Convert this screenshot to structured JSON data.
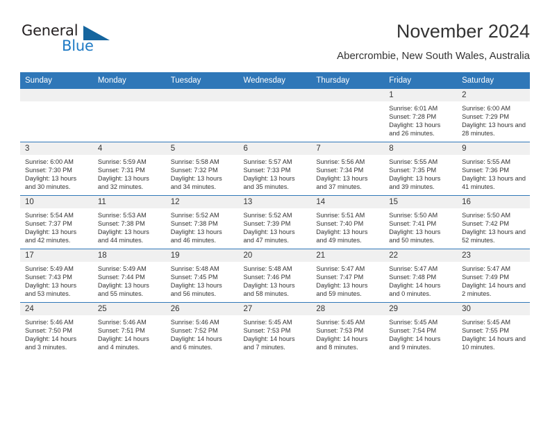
{
  "brand": {
    "name_part1": "General",
    "name_part2": "Blue",
    "triangle_color": "#15659e",
    "blue_color": "#1f7ac4"
  },
  "header": {
    "title": "November 2024",
    "subtitle": "Abercrombie, New South Wales, Australia"
  },
  "theme": {
    "header_bg": "#2f77b8",
    "daynum_band_bg": "#f0f0f0",
    "text": "#333333",
    "grid_line": "#2f77b8"
  },
  "weekdays": [
    "Sunday",
    "Monday",
    "Tuesday",
    "Wednesday",
    "Thursday",
    "Friday",
    "Saturday"
  ],
  "weeks": [
    [
      {
        "day": "",
        "empty": true
      },
      {
        "day": "",
        "empty": true
      },
      {
        "day": "",
        "empty": true
      },
      {
        "day": "",
        "empty": true
      },
      {
        "day": "",
        "empty": true
      },
      {
        "day": "1",
        "sunrise": "Sunrise: 6:01 AM",
        "sunset": "Sunset: 7:28 PM",
        "daylight": "Daylight: 13 hours and 26 minutes."
      },
      {
        "day": "2",
        "sunrise": "Sunrise: 6:00 AM",
        "sunset": "Sunset: 7:29 PM",
        "daylight": "Daylight: 13 hours and 28 minutes."
      }
    ],
    [
      {
        "day": "3",
        "sunrise": "Sunrise: 6:00 AM",
        "sunset": "Sunset: 7:30 PM",
        "daylight": "Daylight: 13 hours and 30 minutes."
      },
      {
        "day": "4",
        "sunrise": "Sunrise: 5:59 AM",
        "sunset": "Sunset: 7:31 PM",
        "daylight": "Daylight: 13 hours and 32 minutes."
      },
      {
        "day": "5",
        "sunrise": "Sunrise: 5:58 AM",
        "sunset": "Sunset: 7:32 PM",
        "daylight": "Daylight: 13 hours and 34 minutes."
      },
      {
        "day": "6",
        "sunrise": "Sunrise: 5:57 AM",
        "sunset": "Sunset: 7:33 PM",
        "daylight": "Daylight: 13 hours and 35 minutes."
      },
      {
        "day": "7",
        "sunrise": "Sunrise: 5:56 AM",
        "sunset": "Sunset: 7:34 PM",
        "daylight": "Daylight: 13 hours and 37 minutes."
      },
      {
        "day": "8",
        "sunrise": "Sunrise: 5:55 AM",
        "sunset": "Sunset: 7:35 PM",
        "daylight": "Daylight: 13 hours and 39 minutes."
      },
      {
        "day": "9",
        "sunrise": "Sunrise: 5:55 AM",
        "sunset": "Sunset: 7:36 PM",
        "daylight": "Daylight: 13 hours and 41 minutes."
      }
    ],
    [
      {
        "day": "10",
        "sunrise": "Sunrise: 5:54 AM",
        "sunset": "Sunset: 7:37 PM",
        "daylight": "Daylight: 13 hours and 42 minutes."
      },
      {
        "day": "11",
        "sunrise": "Sunrise: 5:53 AM",
        "sunset": "Sunset: 7:38 PM",
        "daylight": "Daylight: 13 hours and 44 minutes."
      },
      {
        "day": "12",
        "sunrise": "Sunrise: 5:52 AM",
        "sunset": "Sunset: 7:38 PM",
        "daylight": "Daylight: 13 hours and 46 minutes."
      },
      {
        "day": "13",
        "sunrise": "Sunrise: 5:52 AM",
        "sunset": "Sunset: 7:39 PM",
        "daylight": "Daylight: 13 hours and 47 minutes."
      },
      {
        "day": "14",
        "sunrise": "Sunrise: 5:51 AM",
        "sunset": "Sunset: 7:40 PM",
        "daylight": "Daylight: 13 hours and 49 minutes."
      },
      {
        "day": "15",
        "sunrise": "Sunrise: 5:50 AM",
        "sunset": "Sunset: 7:41 PM",
        "daylight": "Daylight: 13 hours and 50 minutes."
      },
      {
        "day": "16",
        "sunrise": "Sunrise: 5:50 AM",
        "sunset": "Sunset: 7:42 PM",
        "daylight": "Daylight: 13 hours and 52 minutes."
      }
    ],
    [
      {
        "day": "17",
        "sunrise": "Sunrise: 5:49 AM",
        "sunset": "Sunset: 7:43 PM",
        "daylight": "Daylight: 13 hours and 53 minutes."
      },
      {
        "day": "18",
        "sunrise": "Sunrise: 5:49 AM",
        "sunset": "Sunset: 7:44 PM",
        "daylight": "Daylight: 13 hours and 55 minutes."
      },
      {
        "day": "19",
        "sunrise": "Sunrise: 5:48 AM",
        "sunset": "Sunset: 7:45 PM",
        "daylight": "Daylight: 13 hours and 56 minutes."
      },
      {
        "day": "20",
        "sunrise": "Sunrise: 5:48 AM",
        "sunset": "Sunset: 7:46 PM",
        "daylight": "Daylight: 13 hours and 58 minutes."
      },
      {
        "day": "21",
        "sunrise": "Sunrise: 5:47 AM",
        "sunset": "Sunset: 7:47 PM",
        "daylight": "Daylight: 13 hours and 59 minutes."
      },
      {
        "day": "22",
        "sunrise": "Sunrise: 5:47 AM",
        "sunset": "Sunset: 7:48 PM",
        "daylight": "Daylight: 14 hours and 0 minutes."
      },
      {
        "day": "23",
        "sunrise": "Sunrise: 5:47 AM",
        "sunset": "Sunset: 7:49 PM",
        "daylight": "Daylight: 14 hours and 2 minutes."
      }
    ],
    [
      {
        "day": "24",
        "sunrise": "Sunrise: 5:46 AM",
        "sunset": "Sunset: 7:50 PM",
        "daylight": "Daylight: 14 hours and 3 minutes."
      },
      {
        "day": "25",
        "sunrise": "Sunrise: 5:46 AM",
        "sunset": "Sunset: 7:51 PM",
        "daylight": "Daylight: 14 hours and 4 minutes."
      },
      {
        "day": "26",
        "sunrise": "Sunrise: 5:46 AM",
        "sunset": "Sunset: 7:52 PM",
        "daylight": "Daylight: 14 hours and 6 minutes."
      },
      {
        "day": "27",
        "sunrise": "Sunrise: 5:45 AM",
        "sunset": "Sunset: 7:53 PM",
        "daylight": "Daylight: 14 hours and 7 minutes."
      },
      {
        "day": "28",
        "sunrise": "Sunrise: 5:45 AM",
        "sunset": "Sunset: 7:53 PM",
        "daylight": "Daylight: 14 hours and 8 minutes."
      },
      {
        "day": "29",
        "sunrise": "Sunrise: 5:45 AM",
        "sunset": "Sunset: 7:54 PM",
        "daylight": "Daylight: 14 hours and 9 minutes."
      },
      {
        "day": "30",
        "sunrise": "Sunrise: 5:45 AM",
        "sunset": "Sunset: 7:55 PM",
        "daylight": "Daylight: 14 hours and 10 minutes."
      }
    ]
  ]
}
